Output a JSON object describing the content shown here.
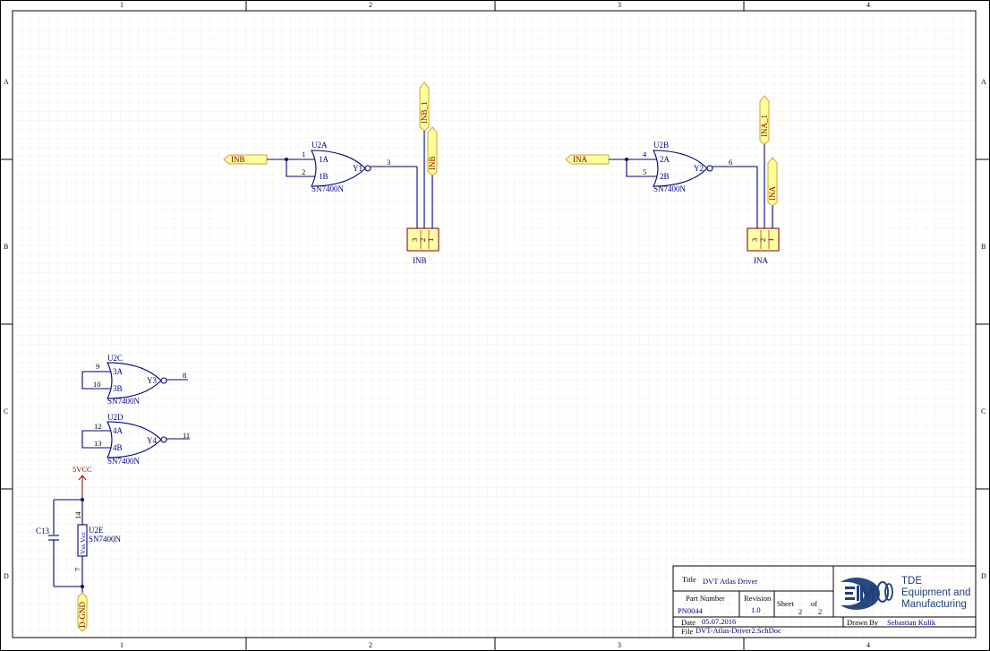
{
  "sheet": {
    "col_labels": [
      "1",
      "2",
      "3",
      "4"
    ],
    "row_labels": [
      "A",
      "B",
      "C",
      "D"
    ]
  },
  "gates": [
    {
      "ref": "U2A",
      "part": "SN7400N",
      "pin_a": "1",
      "pin_b": "2",
      "out_pin": "3",
      "in_a": "1A",
      "in_b": "1B",
      "out": "Y1"
    },
    {
      "ref": "U2B",
      "part": "SN7400N",
      "pin_a": "4",
      "pin_b": "5",
      "out_pin": "6",
      "in_a": "2A",
      "in_b": "2B",
      "out": "Y2"
    },
    {
      "ref": "U2C",
      "part": "SN7400N",
      "pin_a": "9",
      "pin_b": "10",
      "out_pin": "8",
      "in_a": "3A",
      "in_b": "3B",
      "out": "Y3"
    },
    {
      "ref": "U2D",
      "part": "SN7400N",
      "pin_a": "12",
      "pin_b": "13",
      "out_pin": "11",
      "in_a": "4A",
      "in_b": "4B",
      "out": "Y4"
    }
  ],
  "ports": {
    "inb_in": "INB",
    "ina_in": "INA",
    "inb_1": "INB_1",
    "inb_v": "INB",
    "ina_1": "INA_1",
    "ina_v": "INA"
  },
  "headers": [
    {
      "name": "INB",
      "pins": [
        "3",
        "2",
        "1"
      ]
    },
    {
      "name": "INA",
      "pins": [
        "3",
        "2",
        "1"
      ]
    }
  ],
  "power": {
    "vcc_net": "5VCC",
    "gnd_net": "D-GND",
    "cap_ref": "C13",
    "supply_ref": "U2E",
    "supply_part": "SN7400N",
    "supply_inner": "Vss Vcc",
    "pin_top": "14",
    "pin_bottom": "7"
  },
  "title_block": {
    "title_label": "Title",
    "title_value": "DVT Atlas Driver",
    "part_number_label": "Part Number",
    "part_number_value": "PN0044",
    "revision_label": "Revision",
    "revision_value": "1.0",
    "sheet_label": "Sheet",
    "sheet_value": "2",
    "of_label": "of",
    "of_value": "2",
    "date_label": "Date",
    "date_value": "05.07.2016",
    "drawn_by_label": "Drawn By",
    "drawn_by_value": "Sebastian Kulik",
    "file_label": "File",
    "file_value": "DVT-Atlas-Driver2.SchDoc",
    "company_line1": "TDE",
    "company_line2": "Equipment and",
    "company_line3": "Manufacturing"
  },
  "colors": {
    "wire": "#00007f",
    "port_fill": "#ffff99",
    "grid": "#eeeede",
    "logo": "#1f3f77"
  }
}
